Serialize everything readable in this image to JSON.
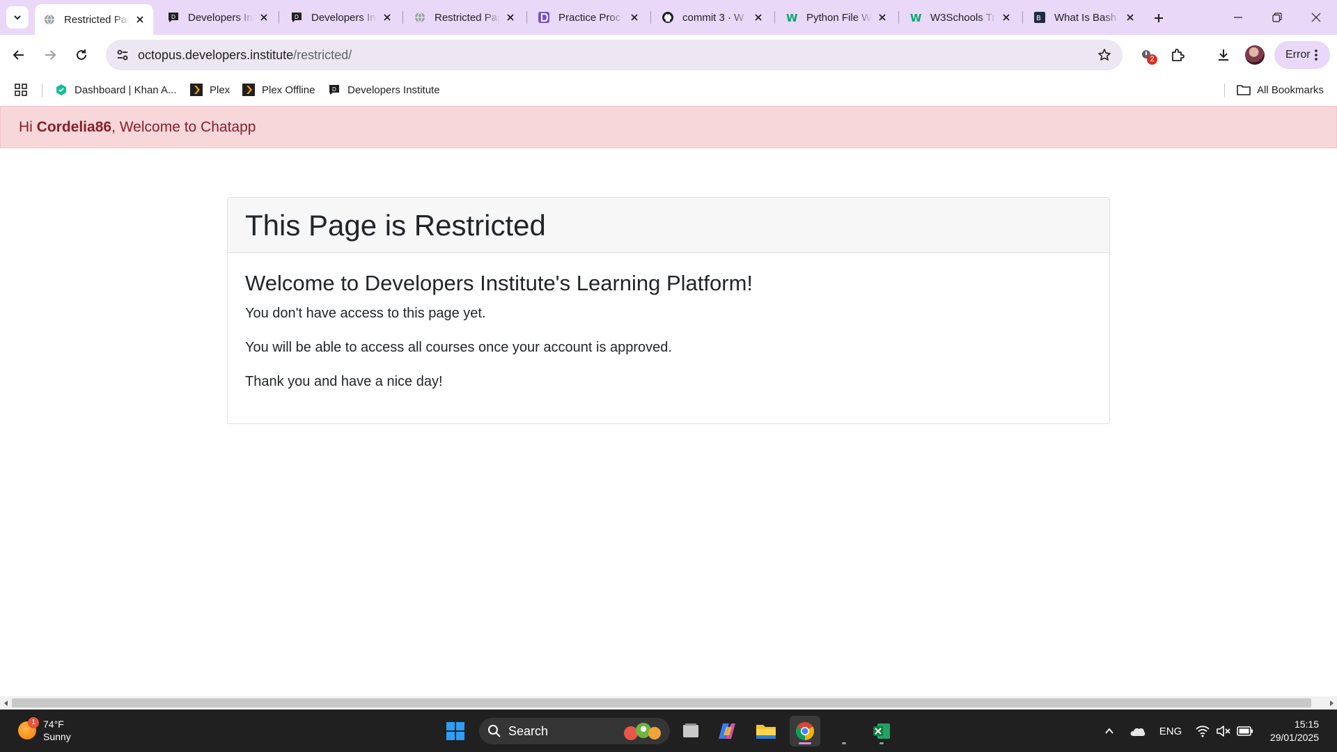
{
  "tabs": [
    {
      "title": "Restricted Page",
      "favicon": "globe-icon",
      "active": true
    },
    {
      "title": "Developers Institute",
      "favicon": "developers-institute-icon",
      "active": false
    },
    {
      "title": "Developers Institute",
      "favicon": "developers-institute-icon",
      "active": false
    },
    {
      "title": "Restricted Page",
      "favicon": "globe-icon",
      "active": false
    },
    {
      "title": "Practice Proc",
      "favicon": "practice-icon",
      "active": false
    },
    {
      "title": "commit 3 · W",
      "favicon": "github-icon",
      "active": false
    },
    {
      "title": "Python File W",
      "favicon": "w3schools-icon",
      "active": false
    },
    {
      "title": "W3Schools Tr",
      "favicon": "w3schools-icon",
      "active": false
    },
    {
      "title": "What Is Bash",
      "favicon": "article-icon",
      "active": false
    }
  ],
  "address": {
    "host": "octopus.developers.institute",
    "path": "/restricted/"
  },
  "toolbar": {
    "extensions_badge": "2",
    "profile_chip": "Error"
  },
  "bookmarks": [
    {
      "label": "Dashboard | Khan A...",
      "icon": "khan-academy-icon"
    },
    {
      "label": "Plex",
      "icon": "plex-icon"
    },
    {
      "label": "Plex Offline",
      "icon": "plex-icon"
    },
    {
      "label": "Developers Institute",
      "icon": "developers-institute-icon"
    }
  ],
  "all_bookmarks_label": "All Bookmarks",
  "alert": {
    "greeting": "Hi ",
    "username": "Cordelia86",
    "suffix": ", Welcome to Chatapp"
  },
  "card": {
    "header": "This Page is Restricted",
    "title": "Welcome to Developers Institute's Learning Platform!",
    "paragraphs": [
      "You don't have access to this page yet.",
      "You will be able to access all courses once your account is approved.",
      "Thank you and have a nice day!"
    ]
  },
  "taskbar": {
    "weather_temp": "74°F",
    "weather_desc": "Sunny",
    "weather_badge": "1",
    "search_label": "Search",
    "language": "ENG",
    "time": "15:15",
    "date": "29/01/2025"
  },
  "colors": {
    "tabstrip_bg": "#e9d8f8",
    "alert_bg": "#f8d7da",
    "alert_text": "#842029",
    "taskbar_bg": "#202020"
  }
}
